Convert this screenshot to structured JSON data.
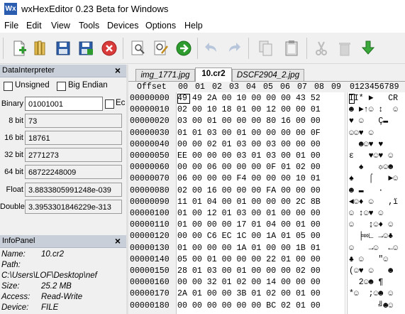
{
  "window": {
    "title": "wxHexEditor 0.23 Beta for Windows",
    "icon_label": "Wx"
  },
  "menu": [
    "File",
    "Edit",
    "View",
    "Tools",
    "Devices",
    "Options",
    "Help"
  ],
  "toolbar_icons": [
    "new-file-icon",
    "open-file-icon",
    "save-icon",
    "save-as-icon",
    "close-file-icon",
    "find-icon",
    "find-replace-icon",
    "goto-icon",
    "undo-icon",
    "redo-icon",
    "copy-icon",
    "paste-icon",
    "cut-icon",
    "delete-icon",
    "insert-icon"
  ],
  "data_interpreter": {
    "title": "DataInterpreter",
    "unsigned_label": "Unsigned",
    "big_endian_label": "Big Endian",
    "rows": [
      {
        "label": "Binary",
        "value": "01001001"
      },
      {
        "label": "8 bit",
        "value": "73"
      },
      {
        "label": "16 bit",
        "value": "18761"
      },
      {
        "label": "32 bit",
        "value": "2771273"
      },
      {
        "label": "64 bit",
        "value": "68722248009"
      },
      {
        "label": "Float",
        "value": "3.8833805991248e-039"
      },
      {
        "label": "Double",
        "value": "3.3953301846229e-313"
      }
    ],
    "edit_checkbox_label": "Ec"
  },
  "info_panel": {
    "title": "InfoPanel",
    "name_key": "Name:",
    "name_val": "10.cr2",
    "path_key": "Path:",
    "path_val": "C:\\Users\\LOF\\Desktop\\nef",
    "size_key": "Size:",
    "size_val": "25.2 MB",
    "access_key": "Access:",
    "access_val": "Read-Write",
    "device_key": "Device:",
    "device_val": "FILE"
  },
  "tabs": [
    "img_1771.jpg",
    "10.cr2",
    "DSCF2904_2.jpg"
  ],
  "hex": {
    "offset_header": "Offset",
    "col_headers": [
      "00",
      "01",
      "02",
      "03",
      "04",
      "05",
      "06",
      "07",
      "08",
      "09"
    ],
    "text_header": "0123456789",
    "rows": [
      {
        "offset": "00000000",
        "bytes": "49 49 2A 00 10 00 00 00 43 52",
        "text": "II* ►   CR"
      },
      {
        "offset": "00000010",
        "bytes": "02 00 10 18 01 00 12 00 00 01",
        "text": "☻ ►↑☺ ↕  ☺"
      },
      {
        "offset": "00000020",
        "bytes": "03 00 01 00 00 00 80 16 00 00",
        "text": "♥ ☺   Ç▬  "
      },
      {
        "offset": "00000030",
        "bytes": "01 01 03 00 01 00 00 00 00 0F",
        "text": "☺☺♥ ☺     "
      },
      {
        "offset": "00000040",
        "bytes": "00 00 02 01 03 00 03 00 00 00",
        "text": "  ☻☺♥ ♥   "
      },
      {
        "offset": "00000050",
        "bytes": "EE 00 00 00 03 01 03 00 01 00",
        "text": "ε   ♥☺♥ ☺ "
      },
      {
        "offset": "00000060",
        "bytes": "00 00 06 00 00 00 0F 01 02 00",
        "text": "  ♠   ☼☺☻ "
      },
      {
        "offset": "00000070",
        "bytes": "06 00 00 00 F4 00 00 00 10 01",
        "text": "♠   ⌠   ►☺"
      },
      {
        "offset": "00000080",
        "bytes": "02 00 16 00 00 00 FA 00 00 00",
        "text": "☻ ▬   ·   "
      },
      {
        "offset": "00000090",
        "bytes": "11 01 04 00 01 00 00 00 2C 8B",
        "text": "◄☺♦ ☺   ,ï"
      },
      {
        "offset": "00000100",
        "bytes": "01 00 12 01 03 00 01 00 00 00",
        "text": "☺ ↕☺♥ ☺   "
      },
      {
        "offset": "00000110",
        "bytes": "01 00 00 00 17 01 04 00 01 00",
        "text": "☺   ↨☺♦ ☺ "
      },
      {
        "offset": "00000120",
        "bytes": "00 00 C6 EC 1C 00 1A 01 05 00",
        "text": "  ╞∞∟ →☺♣ "
      },
      {
        "offset": "00000130",
        "bytes": "01 00 00 00 1A 01 00 00 1B 01",
        "text": "☺   →☺  ←☺"
      },
      {
        "offset": "00000140",
        "bytes": "05 00 01 00 00 00 22 01 00 00",
        "text": "♣ ☺   \"☺  "
      },
      {
        "offset": "00000150",
        "bytes": "28 01 03 00 01 00 00 00 02 00",
        "text": "(☺♥ ☺   ☻ "
      },
      {
        "offset": "00000160",
        "bytes": "00 00 32 01 02 00 14 00 00 00",
        "text": "  2☺☻ ¶   "
      },
      {
        "offset": "00000170",
        "bytes": "2A 01 00 00 3B 01 02 00 01 00",
        "text": "*☺  ;☺☻ ☺ "
      },
      {
        "offset": "00000180",
        "bytes": "00 00 00 00 00 00 BC 02 01 00",
        "text": "      ╝☻☺ "
      }
    ]
  }
}
